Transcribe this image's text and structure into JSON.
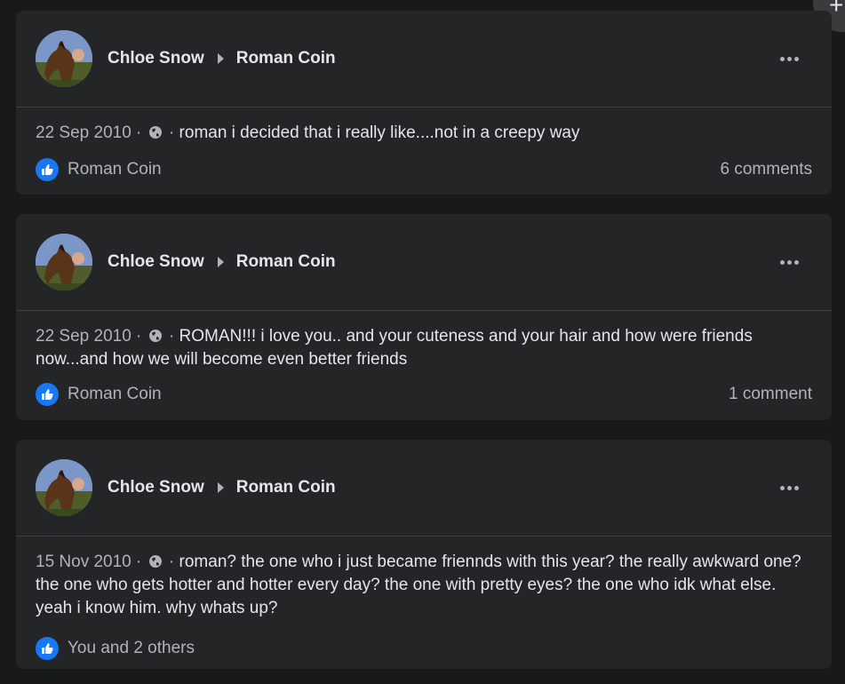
{
  "posts": [
    {
      "author": "Chloe Snow",
      "target": "Roman Coin",
      "date": "22 Sep 2010",
      "text": "roman i decided that i really like....not in a creepy way",
      "likes": "Roman Coin",
      "comments": "6 comments"
    },
    {
      "author": "Chloe Snow",
      "target": "Roman Coin",
      "date": "22 Sep 2010",
      "text": "ROMAN!!! i love you.. and your cuteness and your hair and how were friends now...and how we will become even better friends",
      "likes": "Roman Coin",
      "comments": "1 comment"
    },
    {
      "author": "Chloe Snow",
      "target": "Roman Coin",
      "date": "15 Nov 2010",
      "text": "roman? the one who i just became friennds with this year? the really awkward one? the one who gets hotter and hotter every day? the one with pretty eyes? the one who idk what else. yeah i know him. why whats up?",
      "likes": "You and 2 others",
      "comments": ""
    }
  ],
  "meta_separator": "·",
  "corner_button_label": "+",
  "colors": {
    "background": "#18191a",
    "card": "#242526",
    "primary_text": "#e4e6eb",
    "secondary_text": "#b0b3b8",
    "like_blue": "#1877f2"
  },
  "icons": [
    "globe-icon",
    "like-icon",
    "more-icon",
    "arrow-right-icon",
    "plus-icon"
  ]
}
